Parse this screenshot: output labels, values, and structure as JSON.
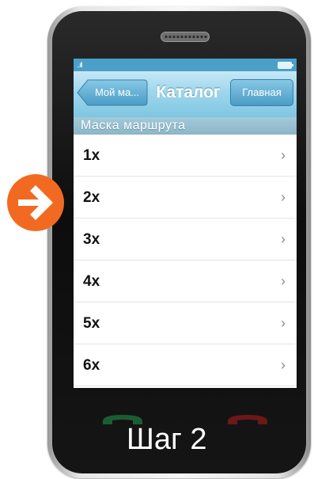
{
  "statusbar": {
    "signal": "..ıll"
  },
  "navbar": {
    "back_label": "Мой ма...",
    "title": "Каталог",
    "home_label": "Главная"
  },
  "section": {
    "header": "Маска маршрута"
  },
  "list": {
    "items": [
      {
        "label": "1x",
        "chevron": "›"
      },
      {
        "label": "2x",
        "chevron": "›"
      },
      {
        "label": "3x",
        "chevron": "›"
      },
      {
        "label": "4x",
        "chevron": "›"
      },
      {
        "label": "5x",
        "chevron": "›"
      },
      {
        "label": "6x",
        "chevron": "›"
      }
    ]
  },
  "step": {
    "label": "Шаг 2"
  },
  "colors": {
    "accent": "#f26a22",
    "navbar": "#9fd6ec",
    "section_header": "#8db6c7",
    "call": "#1d6b3a",
    "end_call": "#7a1a1a"
  },
  "icons": {
    "pointer": "arrow-right-icon",
    "call": "phone-call-icon",
    "end_call": "phone-end-icon"
  }
}
